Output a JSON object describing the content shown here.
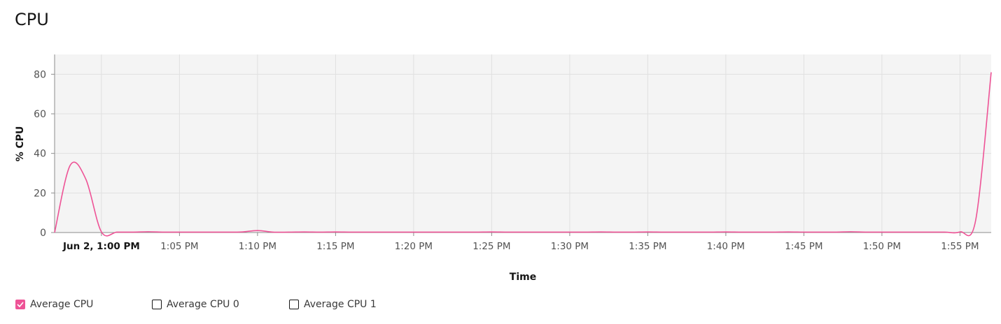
{
  "page": {
    "title": "CPU"
  },
  "legend": {
    "items": [
      {
        "label": "Average CPU",
        "checked": true
      },
      {
        "label": "Average CPU 0",
        "checked": false
      },
      {
        "label": "Average CPU 1",
        "checked": false
      }
    ]
  },
  "colors": {
    "series": "#ee5396",
    "plot_bg": "#f4f4f4",
    "grid": "#e0e0e0",
    "axis": "#8d8d8d"
  },
  "chart_data": {
    "type": "area",
    "title": "CPU",
    "xlabel": "Time",
    "ylabel": "% CPU",
    "xlim": [
      "12:57",
      "13:57"
    ],
    "ylim": [
      0,
      90
    ],
    "yticks": [
      0,
      20,
      40,
      60,
      80
    ],
    "xticks": [
      {
        "time": "13:00",
        "label": "Jun 2, 1:00 PM",
        "bold": true
      },
      {
        "time": "13:05",
        "label": "1:05 PM"
      },
      {
        "time": "13:10",
        "label": "1:10 PM"
      },
      {
        "time": "13:15",
        "label": "1:15 PM"
      },
      {
        "time": "13:20",
        "label": "1:20 PM"
      },
      {
        "time": "13:25",
        "label": "1:25 PM"
      },
      {
        "time": "13:30",
        "label": "1:30 PM"
      },
      {
        "time": "13:35",
        "label": "1:35 PM"
      },
      {
        "time": "13:40",
        "label": "1:40 PM"
      },
      {
        "time": "13:45",
        "label": "1:45 PM"
      },
      {
        "time": "13:50",
        "label": "1:50 PM"
      },
      {
        "time": "13:55",
        "label": "1:55 PM"
      }
    ],
    "grid": true,
    "legend_position": "bottom-left",
    "series": [
      {
        "name": "Average CPU",
        "color": "#ee5396",
        "points": [
          [
            "12:57",
            0
          ],
          [
            "12:58",
            34
          ],
          [
            "12:59",
            27
          ],
          [
            "13:00",
            0.3
          ],
          [
            "13:01",
            0.2
          ],
          [
            "13:02",
            0.2
          ],
          [
            "13:03",
            0.4
          ],
          [
            "13:04",
            0.2
          ],
          [
            "13:05",
            0.2
          ],
          [
            "13:06",
            0.2
          ],
          [
            "13:07",
            0.2
          ],
          [
            "13:08",
            0.2
          ],
          [
            "13:09",
            0.3
          ],
          [
            "13:10",
            1.0
          ],
          [
            "13:11",
            0.2
          ],
          [
            "13:12",
            0.2
          ],
          [
            "13:13",
            0.3
          ],
          [
            "13:14",
            0.2
          ],
          [
            "13:15",
            0.3
          ],
          [
            "13:16",
            0.2
          ],
          [
            "13:17",
            0.2
          ],
          [
            "13:18",
            0.2
          ],
          [
            "13:19",
            0.2
          ],
          [
            "13:20",
            0.2
          ],
          [
            "13:21",
            0.2
          ],
          [
            "13:22",
            0.2
          ],
          [
            "13:23",
            0.2
          ],
          [
            "13:24",
            0.2
          ],
          [
            "13:25",
            0.3
          ],
          [
            "13:26",
            0.2
          ],
          [
            "13:27",
            0.2
          ],
          [
            "13:28",
            0.2
          ],
          [
            "13:29",
            0.2
          ],
          [
            "13:30",
            0.2
          ],
          [
            "13:31",
            0.2
          ],
          [
            "13:32",
            0.3
          ],
          [
            "13:33",
            0.2
          ],
          [
            "13:34",
            0.2
          ],
          [
            "13:35",
            0.3
          ],
          [
            "13:36",
            0.2
          ],
          [
            "13:37",
            0.2
          ],
          [
            "13:38",
            0.2
          ],
          [
            "13:39",
            0.2
          ],
          [
            "13:40",
            0.3
          ],
          [
            "13:41",
            0.2
          ],
          [
            "13:42",
            0.2
          ],
          [
            "13:43",
            0.2
          ],
          [
            "13:44",
            0.3
          ],
          [
            "13:45",
            0.2
          ],
          [
            "13:46",
            0.2
          ],
          [
            "13:47",
            0.2
          ],
          [
            "13:48",
            0.4
          ],
          [
            "13:49",
            0.2
          ],
          [
            "13:50",
            0.2
          ],
          [
            "13:51",
            0.2
          ],
          [
            "13:52",
            0.2
          ],
          [
            "13:53",
            0.2
          ],
          [
            "13:54",
            0.2
          ],
          [
            "13:55",
            0.3
          ],
          [
            "13:56",
            6
          ],
          [
            "13:57",
            81
          ]
        ]
      }
    ]
  }
}
